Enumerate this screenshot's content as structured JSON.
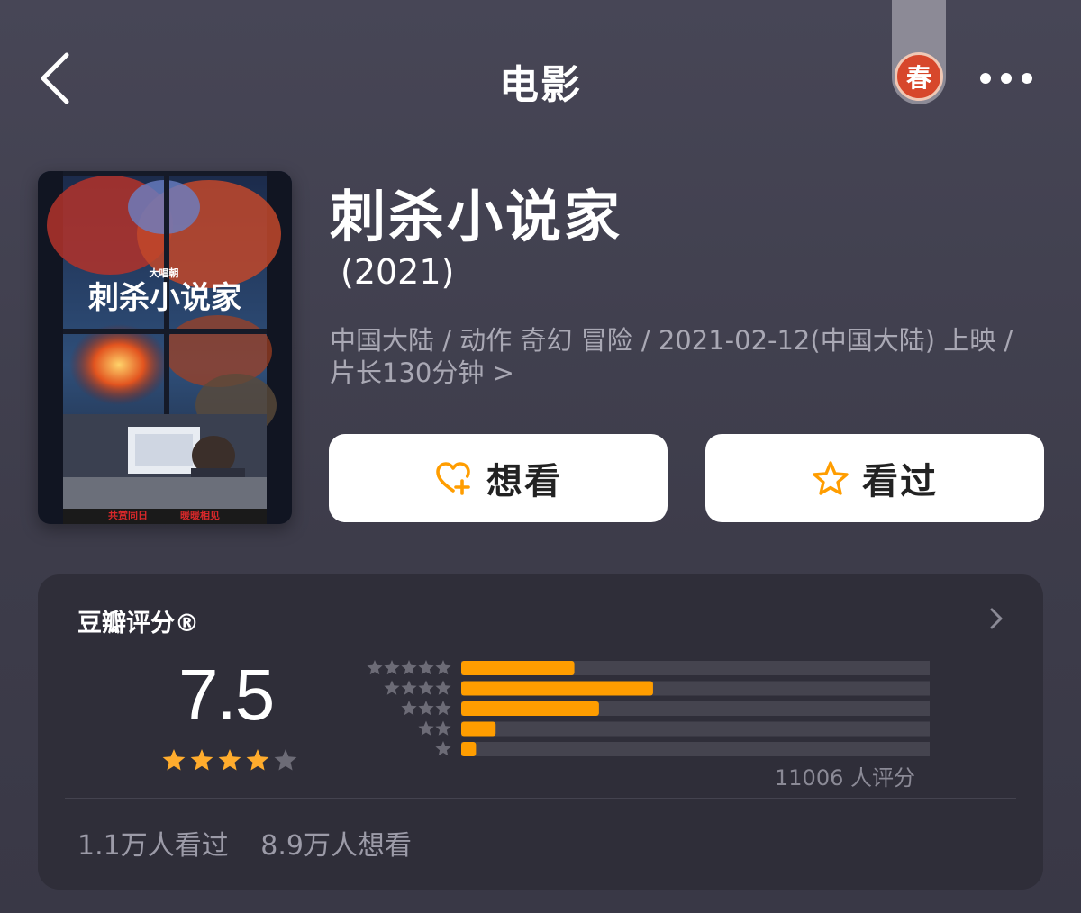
{
  "nav": {
    "title": "电影",
    "spring_badge": "春"
  },
  "movie": {
    "title": "刺杀小说家",
    "year": "(2021)",
    "meta": "中国大陆 / 动作 奇幻 冒险 / 2021-02-12(中国大陆) 上映 / 片长130分钟 >",
    "poster": {
      "top_text": "大唱朝",
      "title_text": "刺杀小说家",
      "bottom_left": "共赏同日",
      "bottom_right": "暖暖相见"
    }
  },
  "actions": {
    "want_label": "想看",
    "seen_label": "看过"
  },
  "rating": {
    "title": "豆瓣评分®",
    "score": "7.5",
    "score_value": 7.5,
    "stars_filled": 4,
    "stars_total": 5,
    "count_text": "11006 人评分",
    "distribution": [
      {
        "stars": 5,
        "percent": 23
      },
      {
        "stars": 4,
        "percent": 39
      },
      {
        "stars": 3,
        "percent": 28
      },
      {
        "stars": 2,
        "percent": 7
      },
      {
        "stars": 1,
        "percent": 3
      }
    ],
    "seen_text": "1.1万人看过",
    "want_text": "8.9万人想看"
  },
  "colors": {
    "accent_orange": "#ff9d00",
    "star_gold": "#ffac2d",
    "background": "#434251",
    "card": "#2f2e39",
    "bar_track": "#45444f",
    "star_gray": "#6c6b76"
  }
}
